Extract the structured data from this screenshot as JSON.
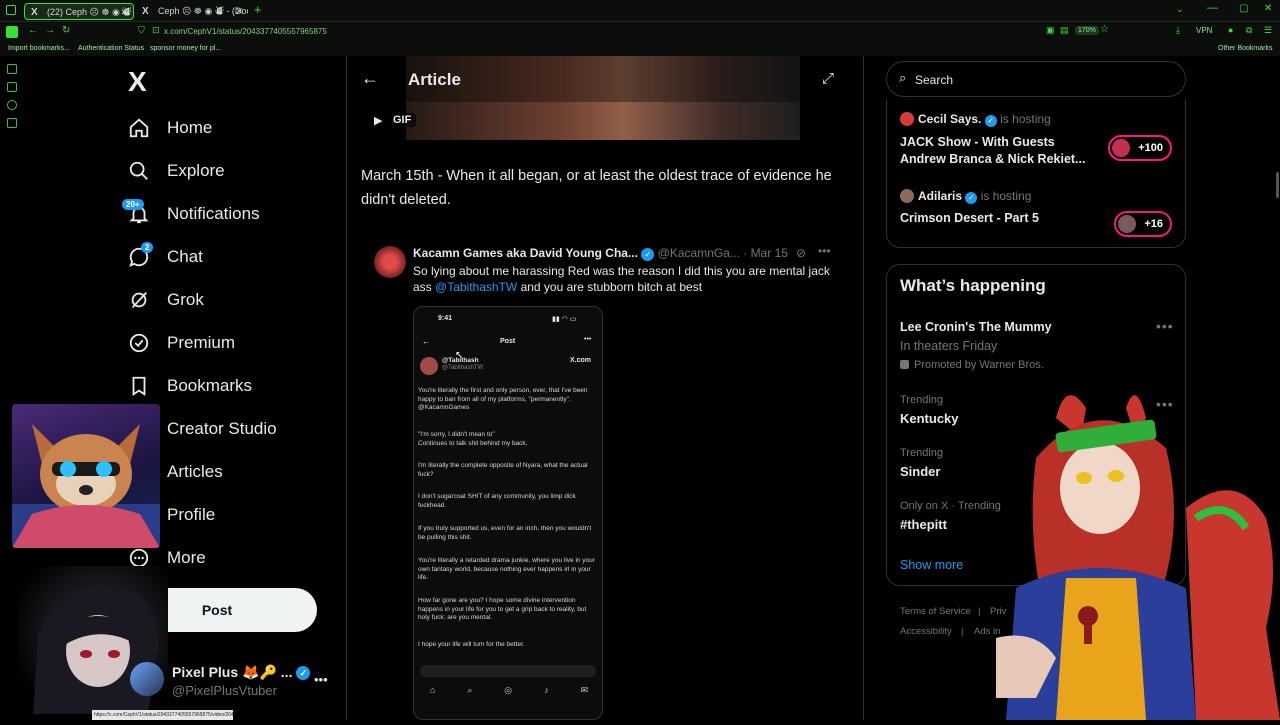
{
  "browser": {
    "tabs": [
      {
        "label": "(22) Ceph ☹ ☸ ◉ ⛇ ✇ - (Doom",
        "active": true
      },
      {
        "label": "Ceph ☹ ☸ ◉ ⛇ - (DoomCh",
        "active": false
      }
    ],
    "new_tab": "+",
    "url": "x.com/CephV1/status/2043377405557965875",
    "zoom": "170%",
    "vpn": "VPN",
    "bookmarks": [
      "Import bookmarks...",
      "Authentication Status",
      "sponsor money for pl..."
    ],
    "other_bookmarks": "Other Bookmarks",
    "status_url": "https://x.com/CephV1/status/2043377405557965875/video/2043136381309491768"
  },
  "nav": {
    "logo": "X",
    "items": [
      {
        "label": "Home",
        "icon": "home-icon"
      },
      {
        "label": "Explore",
        "icon": "search-icon"
      },
      {
        "label": "Notifications",
        "icon": "bell-icon",
        "badge": "20+"
      },
      {
        "label": "Chat",
        "icon": "chat-icon",
        "badge": "2"
      },
      {
        "label": "Grok",
        "icon": "grok-icon"
      },
      {
        "label": "Premium",
        "icon": "premium-icon"
      },
      {
        "label": "Bookmarks",
        "icon": "bookmark-icon"
      },
      {
        "label": "Creator Studio",
        "icon": "creator-icon"
      },
      {
        "label": "Articles",
        "icon": "articles-icon"
      },
      {
        "label": "Profile",
        "icon": "profile-icon"
      },
      {
        "label": "More",
        "icon": "more-icon"
      }
    ],
    "post_button": "Post",
    "account": {
      "name": "Pixel Plus 🦊🔑 ...",
      "handle": "@PixelPlusVtuber",
      "verified": true
    }
  },
  "article": {
    "header_title": "Article",
    "gif_label": "GIF",
    "paragraph": "March 15th - When it all began, or at least the oldest trace of evidence he didn't deleted.",
    "embed": {
      "name": "Kacamn Games aka David Young Cha...",
      "handle": "@KacamnGa...",
      "date": "· Mar 15",
      "text_before": "So lying about me harassing Red was the reason I did this you are mental jack ass ",
      "mention": "@TabithashTW",
      "text_after": " and you are stubborn bitch at best"
    },
    "phone": {
      "time": "9:41",
      "title": "Post",
      "source": "X.com",
      "user": "@Tabithash",
      "handle": "@TabithashTW",
      "lines": [
        "You're literally the first and only person, ever, that I've been happy to ban from all of my platforms, \"permanently\". @KacamnGames",
        "\"I'm sorry, I didn't mean to\"\nContinues to talk shit behind my back.",
        "I'm literally the complete opposite of Nyara, what the actual fuck?",
        "I don't sugarcoat SHIT of any community, you limp dick fuckhead.",
        "If you truly supported us, even for an inch, then you wouldn't be pulling this shit.",
        "You're literally a retarded drama junkie, where you live in your own fantasy world, because nothing ever happens irl in your life.",
        "How far gone are you? I hope some divine intervention happens in your life for you to get a grip back to reality, but holy fuck: are you mental.",
        "I hope your life will turn for the better."
      ]
    }
  },
  "right": {
    "search_placeholder": "Search",
    "spaces": [
      {
        "host": "Cecil Says.",
        "status": "is hosting",
        "title": "JACK Show - With Guests Andrew Branca & Nick Rekiet...",
        "count": "+100"
      },
      {
        "host": "Adilaris",
        "status": "is hosting",
        "title": "Crimson Desert - Part 5",
        "count": "+16"
      }
    ],
    "whats_happening": {
      "heading": "What’s happening",
      "promo": {
        "title": "Lee Cronin's The Mummy",
        "subtitle": "In theaters Friday",
        "promoted_by": "Promoted by Warner Bros."
      },
      "trends": [
        {
          "meta": "Trending",
          "name": "Kentucky"
        },
        {
          "meta": "Trending",
          "name": "Sinder"
        },
        {
          "meta": "Only on X · Trending",
          "name": "#thepitt"
        }
      ],
      "show_more": "Show more"
    },
    "footer": {
      "terms": "Terms of Service",
      "privacy": "Priv",
      "accessibility": "Accessibility",
      "ads": "Ads in"
    }
  },
  "colors": {
    "accent": "#1d9bf0",
    "pink": "#f91880",
    "bg": "#000000",
    "browser_green": "#3ae03a"
  }
}
